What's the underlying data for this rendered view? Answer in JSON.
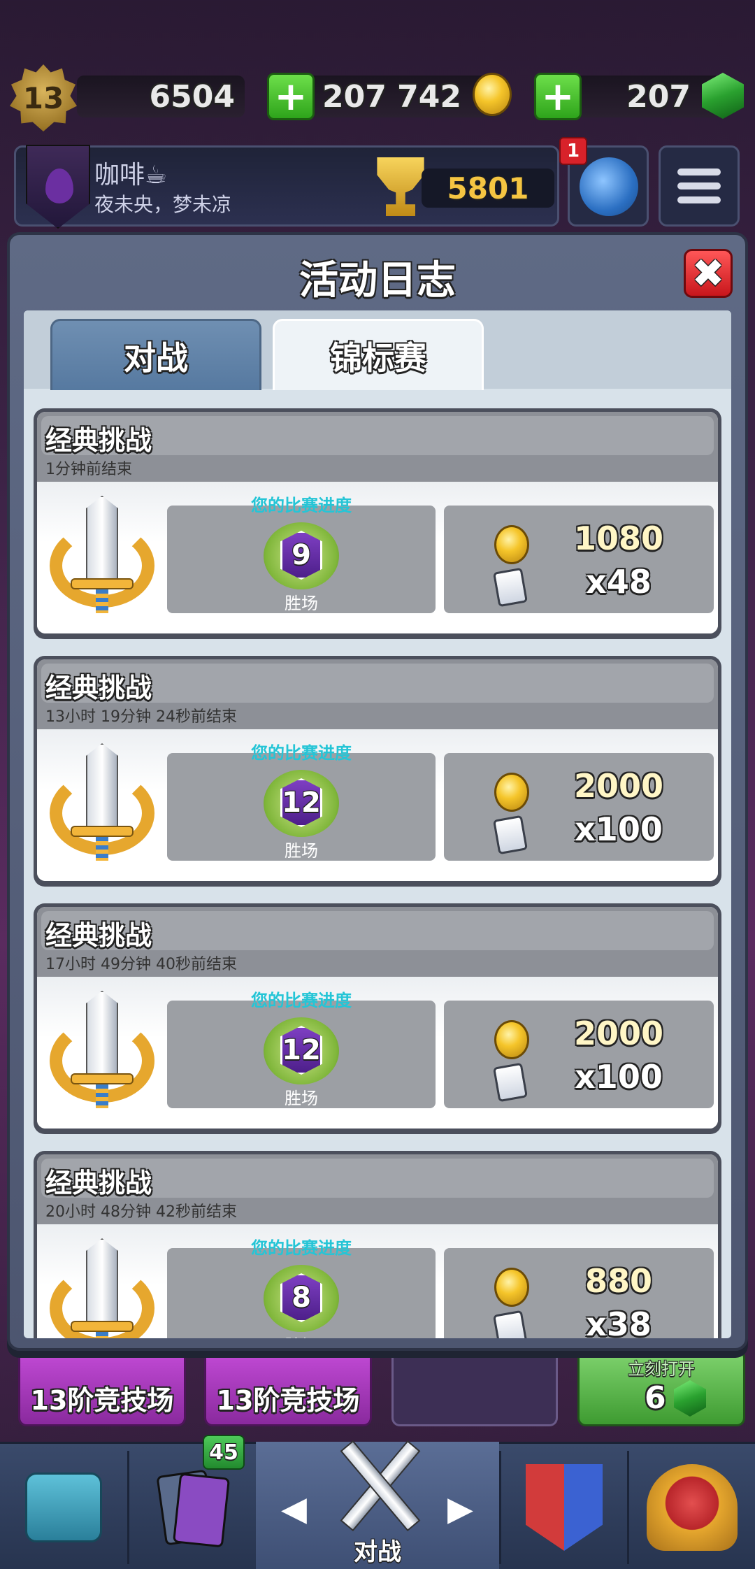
{
  "topbar": {
    "level": "13",
    "experience": "6504",
    "gold": "207 742",
    "gems": "207"
  },
  "profile": {
    "name": "咖啡☕",
    "clan": "夜未央，梦未凉",
    "trophies": "5801",
    "notifications": "1"
  },
  "modal": {
    "title": "活动日志",
    "close_label": "✖",
    "tabs": [
      {
        "label": "对战",
        "active": false
      },
      {
        "label": "锦标赛",
        "active": true
      }
    ]
  },
  "log": {
    "progress_label": "您的比赛进度",
    "wins_label": "胜场",
    "entries": [
      {
        "title": "经典挑战",
        "ended": "1分钟前结束",
        "wins": "9",
        "gold": "1080",
        "cards": "x48"
      },
      {
        "title": "经典挑战",
        "ended": "13小时 19分钟  24秒前结束",
        "wins": "12",
        "gold": "2000",
        "cards": "x100"
      },
      {
        "title": "经典挑战",
        "ended": "17小时 49分钟  40秒前结束",
        "wins": "12",
        "gold": "2000",
        "cards": "x100"
      },
      {
        "title": "经典挑战",
        "ended": "20小时 48分钟  42秒前结束",
        "wins": "8",
        "gold": "880",
        "cards": "x38"
      }
    ]
  },
  "chests": {
    "slot1": "13阶竞技场",
    "slot2": "13阶竞技场",
    "open_now": "立刻打开",
    "open_cost": "6"
  },
  "nav": {
    "cards_badge": "45",
    "battle_label": "对战",
    "left_arrow": "◀",
    "right_arrow": "▶"
  }
}
